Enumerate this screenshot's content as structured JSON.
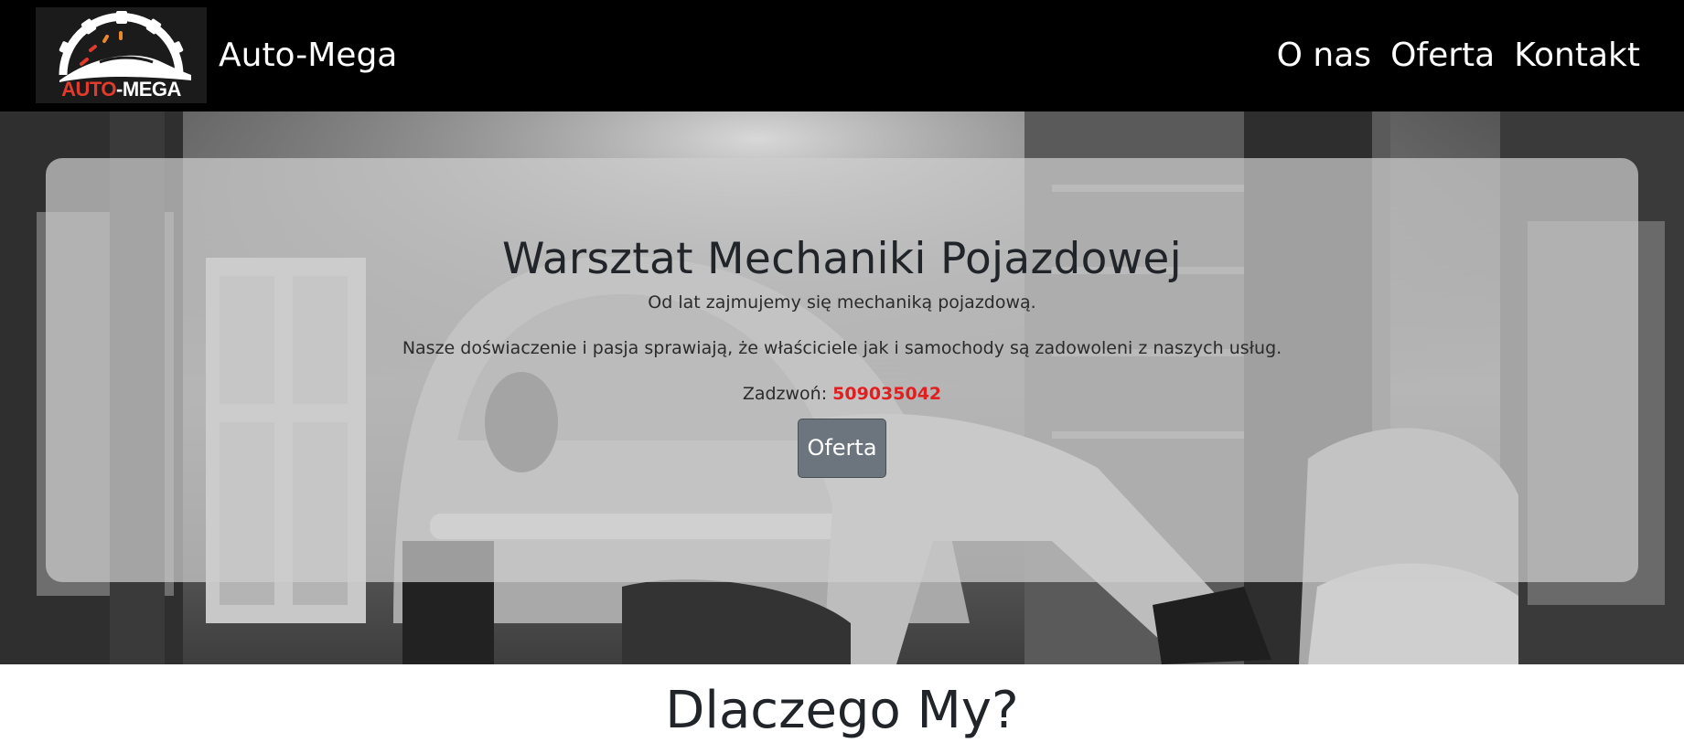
{
  "navbar": {
    "logo": {
      "text_left": "AUTO",
      "text_right": "-MEGA",
      "accent_color": "#e23a2c"
    },
    "brand_name": "Auto-Mega",
    "links": [
      {
        "label": "O nas"
      },
      {
        "label": "Oferta"
      },
      {
        "label": "Kontakt"
      }
    ]
  },
  "hero": {
    "title": "Warsztat Mechaniki Pojazdowej",
    "lead": "Od lat zajmujemy się mechaniką pojazdową.",
    "text": "Nasze doświaczenie i pasja sprawiają, że właściciele jak i samochody są zadowoleni z naszych usług.",
    "phone_label": "Zadzwoń: ",
    "phone_number": "509035042",
    "phone_color": "#e02020",
    "button_label": "Oferta"
  },
  "section": {
    "title": "Dlaczego My?"
  }
}
